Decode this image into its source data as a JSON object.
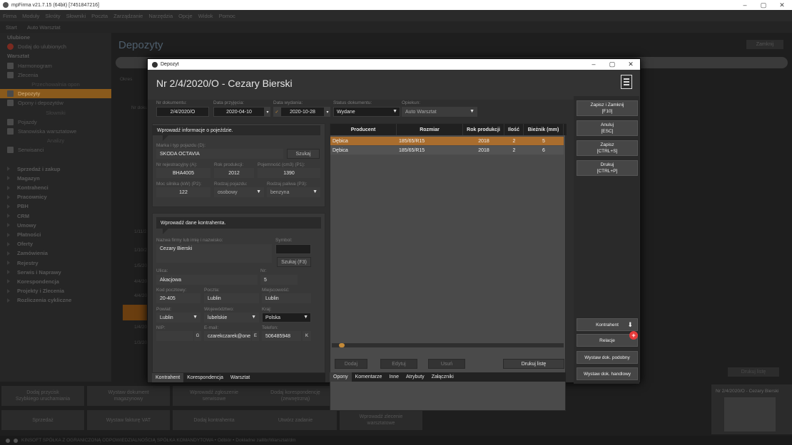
{
  "window": {
    "title": "mpFirma v21.7.15 (64bit) [7451847216]",
    "minimize": "–",
    "maximize": "▢",
    "close": "✕"
  },
  "menu": [
    "Firma",
    "Moduły",
    "Skróty",
    "Słowniki",
    "Poczta",
    "Zarządzanie",
    "Narzędzia",
    "Opcje",
    "Widok",
    "Pomoc"
  ],
  "tabs": [
    "Start",
    "Auto Warsztat"
  ],
  "sidebar": {
    "items": [
      {
        "label": "Ulubione",
        "kind": "bold"
      },
      {
        "label": "Dodaj do ulubionych",
        "kind": "icon-red"
      },
      {
        "label": "Warsztat",
        "kind": "bold"
      },
      {
        "label": "Harmonogram",
        "kind": "icon"
      },
      {
        "label": "Zlecenia",
        "kind": "icon"
      },
      {
        "label": "Przechowalnia opon",
        "kind": "center"
      },
      {
        "label": "Depozyty",
        "kind": "active"
      },
      {
        "label": "Opony i depozytów",
        "kind": "icon"
      },
      {
        "label": "Słowniki",
        "kind": "center"
      },
      {
        "label": "Pojazdy",
        "kind": "icon"
      },
      {
        "label": "Stanowiska warsztatowe",
        "kind": "icon"
      },
      {
        "label": "Analizy",
        "kind": "center"
      },
      {
        "label": "Serwisanci",
        "kind": "icon"
      },
      {
        "label": "",
        "kind": "blank"
      },
      {
        "label": "Sprzedaż i zakup",
        "kind": "section"
      },
      {
        "label": "Magazyn",
        "kind": "section"
      },
      {
        "label": "Kontrahenci",
        "kind": "section"
      },
      {
        "label": "Pracownicy",
        "kind": "section"
      },
      {
        "label": "PBH",
        "kind": "section"
      },
      {
        "label": "CRM",
        "kind": "section"
      },
      {
        "label": "Umowy",
        "kind": "section"
      },
      {
        "label": "Płatności",
        "kind": "section"
      },
      {
        "label": "Oferty",
        "kind": "section"
      },
      {
        "label": "Zamówienia",
        "kind": "section"
      },
      {
        "label": "Rejestry",
        "kind": "section"
      },
      {
        "label": "Serwis i Naprawy",
        "kind": "section"
      },
      {
        "label": "Korespondencja",
        "kind": "section"
      },
      {
        "label": "Projekty i Zlecenia",
        "kind": "section"
      },
      {
        "label": "Rozliczenia cykliczne",
        "kind": "section"
      }
    ]
  },
  "background": {
    "title": "Depozyty",
    "zamknij": "Zamknij",
    "column_label": "Okres",
    "nr_label": "Nr doku",
    "dates": [
      "1/11/2",
      "1/10/2",
      "1/5/20",
      "4/4/20",
      "4/4/20",
      "2/4/20",
      "1/4/20",
      "1/3/20"
    ],
    "drukuj": "Drukuj listę"
  },
  "bottom_actions": [
    "Dodaj przycisk\nSzybkiego uruchamiania",
    "Wystaw dokument\nmagazynowy",
    "Wprowadź zgłoszenie\nserwisowe",
    "Dodaj korespondencję\n(zewnętrzną)",
    "Wystaw zamówienie",
    "Wystaw ofertę",
    "Sprzedaż",
    "Wystaw fakturę VAT",
    "Dodaj kontrahenta",
    "Utwórz zadanie",
    "Wprowadź zlecenie\nwarsztatowe"
  ],
  "thumbnail_title": "Nr 2/4/2020/O - Cezary Bierski",
  "statusbar": "KINSOFT SPÓŁKA Z OGRANICZONĄ ODPOWIEDZIALNOŚCIĄ SPÓŁKA KOMANDYTOWA • Odbiór • Dokładne zalllbr/Warsztat/dm",
  "dialog": {
    "window_title": "Depozyt",
    "doc_title": "Nr 2/4/2020/O - Cezary Bierski",
    "nr_dokumentu": {
      "label": "Nr dokumentu:",
      "value": "2/4/2020/O"
    },
    "data_przyjecia": {
      "label": "Data przyjęcia:",
      "value": "2020-04-10"
    },
    "data_wydania": {
      "label": "Data wydania:",
      "value": "2020-10-28"
    },
    "status": {
      "label": "Status dokumentu:",
      "value": "Wydane"
    },
    "opiekun": {
      "label": "Opiekun:",
      "value": "Auto Warsztat"
    },
    "vehicle": {
      "heading": "Wprowadź informacje o pojeździe.",
      "marka_label": "Marka i typ pojazdu (D):",
      "marka_value": "SKODA OCTAVIA",
      "szukaj": "Szukaj",
      "nr_rej_label": "Nr rejestracyjny (A):",
      "nr_rej_value": "BHA4005",
      "rok_label": "Rok produkcji:",
      "rok_value": "2012",
      "pojemnosc_label": "Pojemność (cm3) (P1):",
      "pojemnosc_value": "1390",
      "moc_label": "Moc silnika (kW) (P2):",
      "moc_value": "122",
      "rodzaj_label": "Rodzaj pojazdu:",
      "rodzaj_value": "osobowy",
      "paliwo_label": "Rodzaj paliwa (P3):",
      "paliwo_value": "benzyna"
    },
    "contractor": {
      "heading": "Wprowadź dane kontrahenta.",
      "nazwa_label": "Nazwa firmy lub imię i nazwisko:",
      "nazwa_value": "Cezary Bierski",
      "symbol_label": "Symbol:",
      "symbol_value": "",
      "szukaj": "Szukaj (F3)",
      "ulica_label": "Ulica:",
      "ulica_value": "Akacjowa",
      "nr_label": "Nr:",
      "nr_value": "5",
      "kod_label": "Kod pocztowy:",
      "kod_value": "20-405",
      "poczta_label": "Poczta:",
      "poczta_value": "Lublin",
      "miejscowosc_label": "Miejscowość:",
      "miejscowosc_value": "Lublin",
      "powiat_label": "Powiat:",
      "powiat_value": "Lublin",
      "woj_label": "Województwo:",
      "woj_value": "lubelskie",
      "kraj_label": "Kraj:",
      "kraj_value": "Polska",
      "nip_label": "NIP:",
      "nip_value": "",
      "nip_btn": "G",
      "email_label": "E-mail:",
      "email_value": "czarekczarek@one",
      "email_btn": "E",
      "tel_label": "Telefon:",
      "tel_value": "506485948",
      "tel_btn": "K"
    },
    "left_tabs": [
      "Kontrahent",
      "Korespondencja",
      "Warsztat"
    ],
    "grid": {
      "columns": [
        "Producent",
        "Rozmiar",
        "Rok produkcji",
        "Ilość",
        "Bieżnik (mm)"
      ],
      "rows": [
        [
          "Dębica",
          "185/65/R15",
          "2018",
          "2",
          "5"
        ],
        [
          "Dębica",
          "185/65/R15",
          "2018",
          "2",
          "6"
        ]
      ]
    },
    "grid_buttons": {
      "dodaj": "Dodaj",
      "edytuj": "Edytuj",
      "usun": "Usuń",
      "drukuj_liste": "Drukuj listę"
    },
    "grid_tabs": [
      "Opony",
      "Komentarze",
      "Inne",
      "Atrybuty",
      "Załączniki"
    ],
    "right_buttons": {
      "zapisz_zamknij": "Zapisz i Zamknij\n[F10]",
      "anuluj": "Anuluj\n[ESC]",
      "zapisz": "Zapisz\n[CTRL+S]",
      "drukuj": "Drukuj\n[CTRL+P]",
      "kontrahent": "Kontrahent",
      "relacje": "Relacje",
      "relacje_badge": "+",
      "wystaw_podobny": "Wystaw dok. podobny",
      "wystaw_handlowy": "Wystaw dok. handlowy"
    }
  }
}
